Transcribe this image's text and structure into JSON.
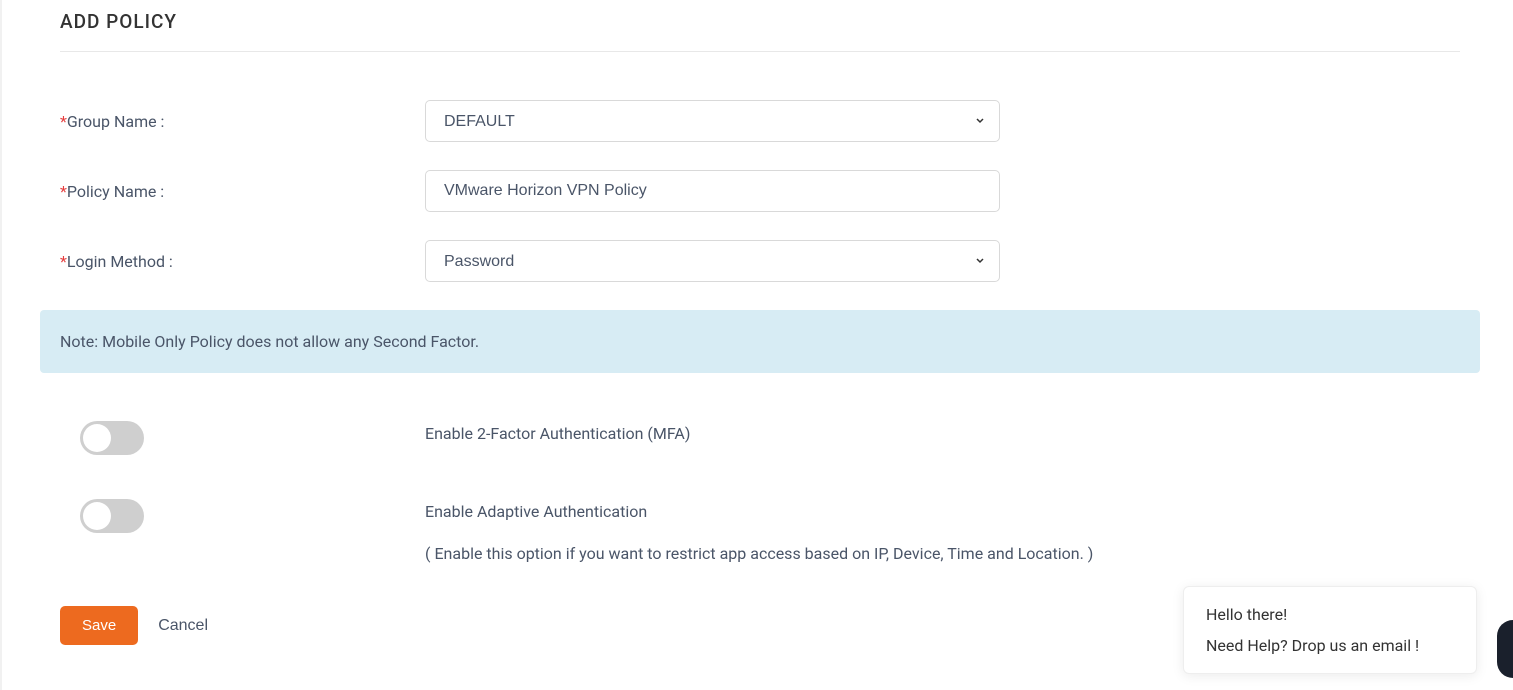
{
  "title": "ADD POLICY",
  "form": {
    "group_name": {
      "label": "Group Name :",
      "value": "DEFAULT"
    },
    "policy_name": {
      "label": "Policy Name :",
      "value": "VMware Horizon VPN Policy"
    },
    "login_method": {
      "label": "Login Method :",
      "value": "Password"
    }
  },
  "note": "Note: Mobile Only Policy does not allow any Second Factor.",
  "toggles": {
    "mfa": {
      "label": "Enable 2-Factor Authentication (MFA)",
      "enabled": false
    },
    "adaptive": {
      "label": "Enable Adaptive Authentication",
      "subtext": "( Enable this option if you want to restrict app access based on IP, Device, Time and Location. )",
      "enabled": false
    }
  },
  "actions": {
    "save": "Save",
    "cancel": "Cancel"
  },
  "help": {
    "greeting": "Hello there!",
    "message": "Need Help? Drop us an email !"
  }
}
